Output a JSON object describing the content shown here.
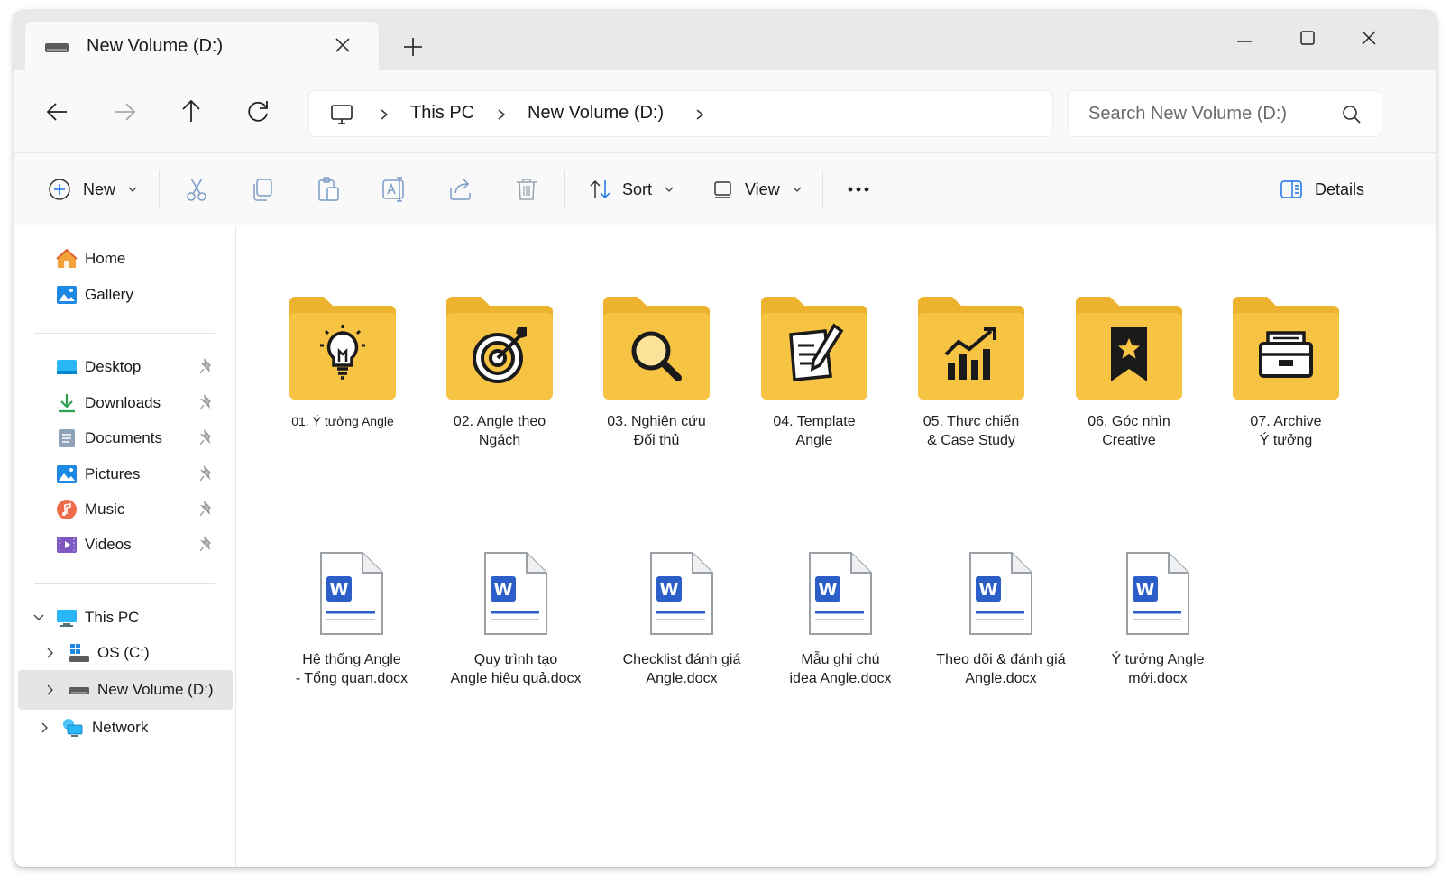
{
  "tab": {
    "title": "New Volume (D:)"
  },
  "address": {
    "crumbs": [
      "This PC",
      "New Volume (D:)"
    ]
  },
  "search": {
    "placeholder": "Search New Volume (D:)"
  },
  "toolbar": {
    "new_label": "New",
    "sort_label": "Sort",
    "view_label": "View",
    "details_label": "Details"
  },
  "sidebar": {
    "home": "Home",
    "gallery": "Gallery",
    "quick": [
      {
        "label": "Desktop",
        "icon": "desktop-icon"
      },
      {
        "label": "Downloads",
        "icon": "downloads-icon"
      },
      {
        "label": "Documents",
        "icon": "documents-icon"
      },
      {
        "label": "Pictures",
        "icon": "pictures-icon"
      },
      {
        "label": "Music",
        "icon": "music-icon"
      },
      {
        "label": "Videos",
        "icon": "videos-icon"
      }
    ],
    "this_pc": "This PC",
    "os_c": "OS (C:)",
    "new_volume": "New Volume (D:)",
    "network": "Network"
  },
  "folders": [
    {
      "line1": "01. Ý tưởng Angle",
      "line2": "",
      "icon": "lightbulb-icon"
    },
    {
      "line1": "02. Angle theo",
      "line2": "Ngách",
      "icon": "target-icon"
    },
    {
      "line1": "03. Nghiên cứu",
      "line2": "Đối thủ",
      "icon": "magnifier-icon"
    },
    {
      "line1": "04. Template",
      "line2": "Angle",
      "icon": "document-pen-icon"
    },
    {
      "line1": "05. Thực chiến",
      "line2": "& Case Study",
      "icon": "bar-chart-icon"
    },
    {
      "line1": "06. Góc nhìn",
      "line2": "Creative",
      "icon": "bookmark-star-icon"
    },
    {
      "line1": "07. Archive",
      "line2": "Ý tưởng",
      "icon": "archive-box-icon"
    }
  ],
  "files": [
    {
      "line1": "Hệ thống Angle",
      "line2": "- Tổng quan.docx"
    },
    {
      "line1": "Quy trình tạo",
      "line2": "Angle hiệu quả.docx"
    },
    {
      "line1": "Checklist đánh giá",
      "line2": "Angle.docx"
    },
    {
      "line1": "Mẫu ghi chú",
      "line2": "idea Angle.docx"
    },
    {
      "line1": "Theo dõi & đánh giá",
      "line2": "Angle.docx"
    },
    {
      "line1": "Ý tưởng Angle",
      "line2": "mới.docx"
    }
  ],
  "colors": {
    "folder": "#f6c343",
    "folder_back": "#eeb32e",
    "word_blue": "#2b5fc7",
    "accent": "#1a73e8"
  }
}
